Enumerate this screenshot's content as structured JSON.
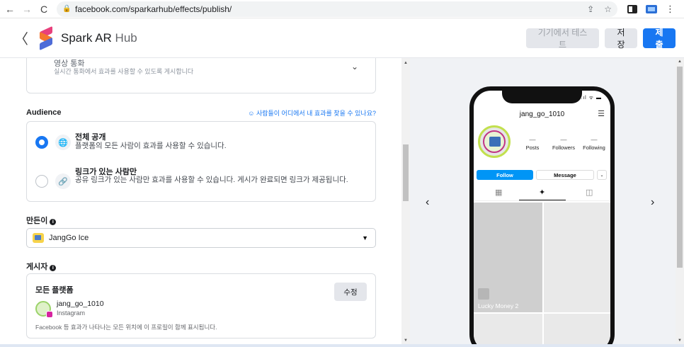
{
  "browser": {
    "back": "←",
    "forward": "→",
    "reload": "C",
    "url": "facebook.com/sparkarhub/effects/publish/",
    "share_icon": "⇪",
    "star_icon": "☆",
    "menu_icon": "⋮"
  },
  "header": {
    "back_icon": "〈",
    "brand_main": "Spark AR",
    "brand_hub": " Hub",
    "test_button": "기기에서 테스트",
    "save_button": "저장",
    "submit_button": "제출"
  },
  "top_section": {
    "title": "영상 통화",
    "description": "실시간 통화에서 효과를 사용할 수 있도록 게시합니다",
    "chevron": "⌄"
  },
  "audience": {
    "label": "Audience",
    "help_icon": "☺",
    "help_link": "사람들이 어디에서 내 효과를 찾을 수 있나요?",
    "options": [
      {
        "title": "전체 공개",
        "description": "플랫폼의 모든 사람이 효과를 사용할 수 있습니다.",
        "icon": "🌐",
        "selected": true
      },
      {
        "title": "링크가 있는 사람만",
        "description": "공유 링크가 있는 사람만 효과를 사용할 수 있습니다. 게시가 완료되면 링크가 제공됩니다.",
        "icon": "🔗",
        "selected": false
      }
    ]
  },
  "creator": {
    "label": "만든이",
    "info": "i",
    "value": "JangGo Ice",
    "caret": "▼"
  },
  "publisher": {
    "label": "게시자",
    "info": "i",
    "card_title": "모든 플랫폼",
    "edit_button": "수정",
    "username": "jang_go_1010",
    "platform": "Instagram",
    "note": "Facebook 등 효과가 나타나는 모든 위치에 이 프로필이 함께 표시됩니다."
  },
  "preview": {
    "prev_arrow": "‹",
    "next_arrow": "›",
    "status": ".ıl ᯤ ▬",
    "username": "jang_go_1010",
    "menu_icon": "☰",
    "stats": [
      {
        "value": "—",
        "label": "Posts"
      },
      {
        "value": "—",
        "label": "Followers"
      },
      {
        "value": "—",
        "label": "Following"
      }
    ],
    "follow_button": "Follow",
    "message_button": "Message",
    "more_button": "⌄",
    "tab_grid_icon": "▦",
    "tab_effects_icon": "✦",
    "tab_tagged_icon": "◫",
    "effect_label": "Lucky Money 2"
  },
  "colors": {
    "accent": "#1877f2",
    "instagram_blue": "#0095f6"
  }
}
